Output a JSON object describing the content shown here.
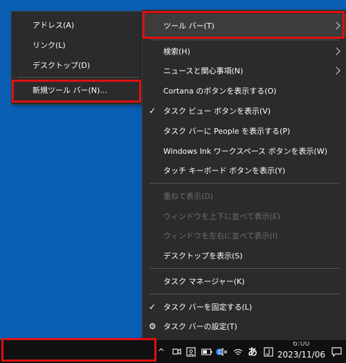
{
  "left_menu": {
    "items": [
      {
        "label": "アドレス(A)"
      },
      {
        "label": "リンク(L)"
      },
      {
        "label": "デスクトップ(D)"
      },
      {
        "label": "新規ツール バー(N)..."
      }
    ]
  },
  "main_menu": {
    "items": [
      {
        "label": "ツール バー(T)"
      },
      {
        "label": "検索(H)"
      },
      {
        "label": "ニュースと関心事項(N)"
      },
      {
        "label": "Cortana のボタンを表示する(O)"
      },
      {
        "label": "タスク ビュー ボタンを表示(V)"
      },
      {
        "label": "タスク バーに People を表示する(P)"
      },
      {
        "label": "Windows Ink ワークスペース ボタンを表示(W)"
      },
      {
        "label": "タッチ キーボード ボタンを表示(Y)"
      },
      {
        "label": "重ねて表示(D)"
      },
      {
        "label": "ウィンドウを上下に並べて表示(E)"
      },
      {
        "label": "ウィンドウを左右に並べて表示(I)"
      },
      {
        "label": "デスクトップを表示(S)"
      },
      {
        "label": "タスク マネージャー(K)"
      },
      {
        "label": "タスク バーを固定する(L)"
      },
      {
        "label": "タスク バーの設定(T)"
      }
    ],
    "check_glyph": "✓",
    "gear_glyph": "⚙"
  },
  "taskbar": {
    "ime_label": "あ",
    "clock_time": "6:00",
    "clock_date": "2023/11/06",
    "tray_up_glyph": "^",
    "highlight_color": "#e01010"
  }
}
